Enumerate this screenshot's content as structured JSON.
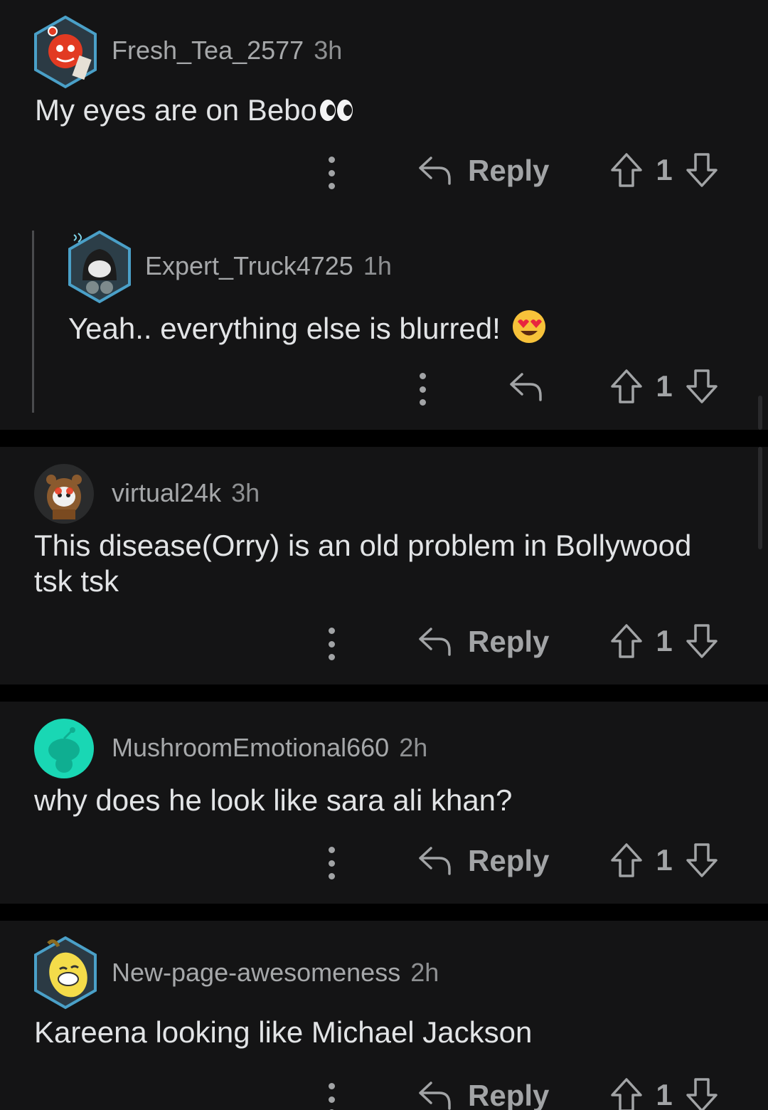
{
  "colors": {
    "background": "#000000",
    "card": "#141415",
    "text": "#e2e4e6",
    "muted": "#a2a4a6"
  },
  "comments": [
    {
      "username": "Fresh_Tea_2577",
      "time": "3h",
      "body": "My eyes are on Bebo",
      "emoji": "eyes-emoji",
      "reply_label": "Reply",
      "score": "1",
      "avatar": "red-snoo-avatar"
    },
    {
      "username": "Expert_Truck4725",
      "time": "1h",
      "body": "Yeah.. everything else is blurred!",
      "emoji": "heart-eyes-emoji",
      "reply_label": "",
      "score": "1",
      "avatar": "hooded-snoo-avatar"
    },
    {
      "username": "virtual24k",
      "time": "3h",
      "body": "This disease(Orry) is an old problem in Bollywood tsk tsk",
      "reply_label": "Reply",
      "score": "1",
      "avatar": "bear-snoo-avatar"
    },
    {
      "username": "MushroomEmotional660",
      "time": "2h",
      "body": "why does he look like sara ali khan?",
      "reply_label": "Reply",
      "score": "1",
      "avatar": "default-snoo-avatar"
    },
    {
      "username": "New-page-awesomeness",
      "time": "2h",
      "body": "Kareena looking like Michael Jackson",
      "reply_label": "Reply",
      "score": "1",
      "avatar": "banana-snoo-avatar"
    }
  ]
}
